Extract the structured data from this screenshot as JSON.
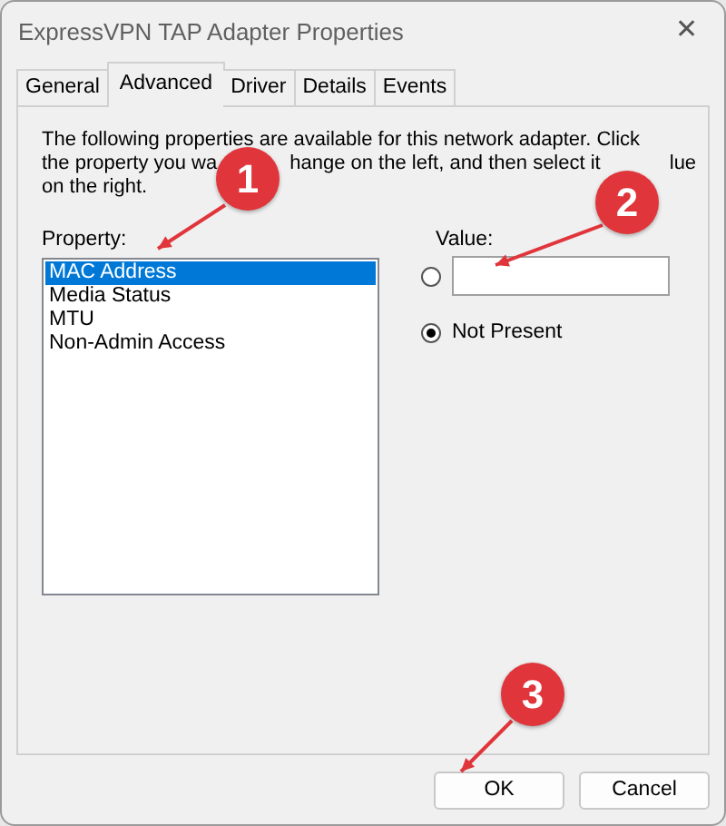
{
  "window": {
    "title": "ExpressVPN TAP Adapter Properties",
    "close": "✕"
  },
  "tabs": [
    {
      "label": "General",
      "selected": false
    },
    {
      "label": "Advanced",
      "selected": true
    },
    {
      "label": "Driver",
      "selected": false
    },
    {
      "label": "Details",
      "selected": false
    },
    {
      "label": "Events",
      "selected": false
    }
  ],
  "description": [
    [
      "The following properties are available for this network adapter. Click"
    ],
    [
      "the property you wa",
      "hange on the left, and then select it",
      "lue"
    ],
    [
      "on the right."
    ]
  ],
  "property": {
    "label": "Property:",
    "items": [
      {
        "label": "MAC Address",
        "selected": true
      },
      {
        "label": "Media Status",
        "selected": false
      },
      {
        "label": "MTU",
        "selected": false
      },
      {
        "label": "Non-Admin Access",
        "selected": false
      }
    ]
  },
  "value": {
    "label": "Value:",
    "options": [
      {
        "kind": "field",
        "selected": false
      },
      {
        "kind": "label",
        "label": "Not Present",
        "selected": true
      }
    ]
  },
  "buttons": [
    "OK",
    "Cancel"
  ],
  "annotations": [
    {
      "label": "1"
    },
    {
      "label": "2"
    },
    {
      "label": "3"
    }
  ]
}
